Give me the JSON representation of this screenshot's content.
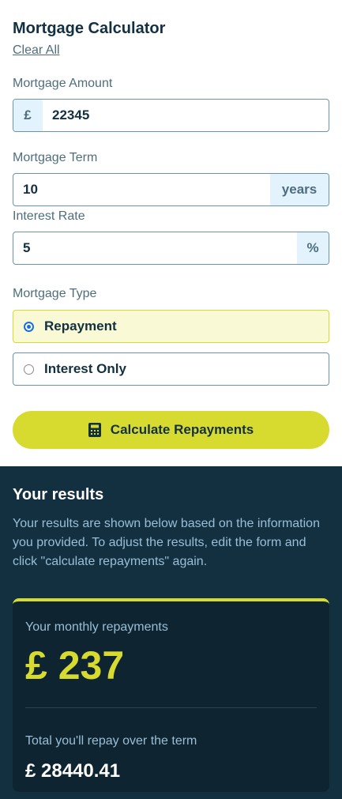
{
  "form": {
    "title": "Mortgage Calculator",
    "clear_all": "Clear All",
    "amount": {
      "label": "Mortgage Amount",
      "prefix": "£",
      "value": "22345"
    },
    "term": {
      "label": "Mortgage Term",
      "value": "10",
      "suffix": "years"
    },
    "rate": {
      "label": "Interest Rate",
      "value": "5",
      "suffix": "%"
    },
    "type": {
      "label": "Mortgage Type",
      "options": [
        {
          "label": "Repayment",
          "selected": true
        },
        {
          "label": "Interest Only",
          "selected": false
        }
      ]
    },
    "calculate_button": "Calculate Repayments",
    "calculate_icon": "calculator-icon"
  },
  "results": {
    "title": "Your results",
    "description": "Your results are shown below based on the information you provided. To adjust the results, edit the form and click \"calculate repayments\" again.",
    "monthly_label": "Your monthly repayments",
    "monthly_value": "£ 237",
    "total_label": "Total you'll repay over the term",
    "total_value": "£ 28440.41"
  },
  "colors": {
    "accent": "#d8db2f",
    "dark": "#133041",
    "darker": "#0e2431",
    "muted": "#4e6e7e",
    "addon_bg": "#e3f3fd"
  }
}
